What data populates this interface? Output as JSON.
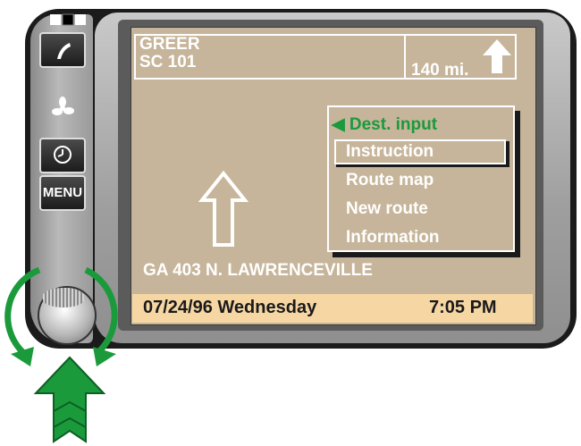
{
  "header": {
    "dest_city": "GREER",
    "dest_road": "SC 101",
    "distance": "140 mi."
  },
  "menu": {
    "items": [
      {
        "label": "◀ Dest. input",
        "color": "#1b9a3c"
      },
      {
        "label": "Instruction",
        "selected": true
      },
      {
        "label": "Route map"
      },
      {
        "label": "New route"
      },
      {
        "label": "Information"
      }
    ]
  },
  "current_street": "GA 403 N. LAWRENCEVILLE",
  "status": {
    "date": "07/24/96 Wednesday",
    "time": "7:05 PM"
  },
  "controls": {
    "menu_button_label": "MENU",
    "icons": [
      "phone-icon",
      "fan-icon",
      "clock-icon",
      "rotary-knob"
    ]
  },
  "colors": {
    "screen_bg": "#c6b59a",
    "status_bg": "#f6d7a4",
    "accent_green": "#1b9a3c"
  }
}
